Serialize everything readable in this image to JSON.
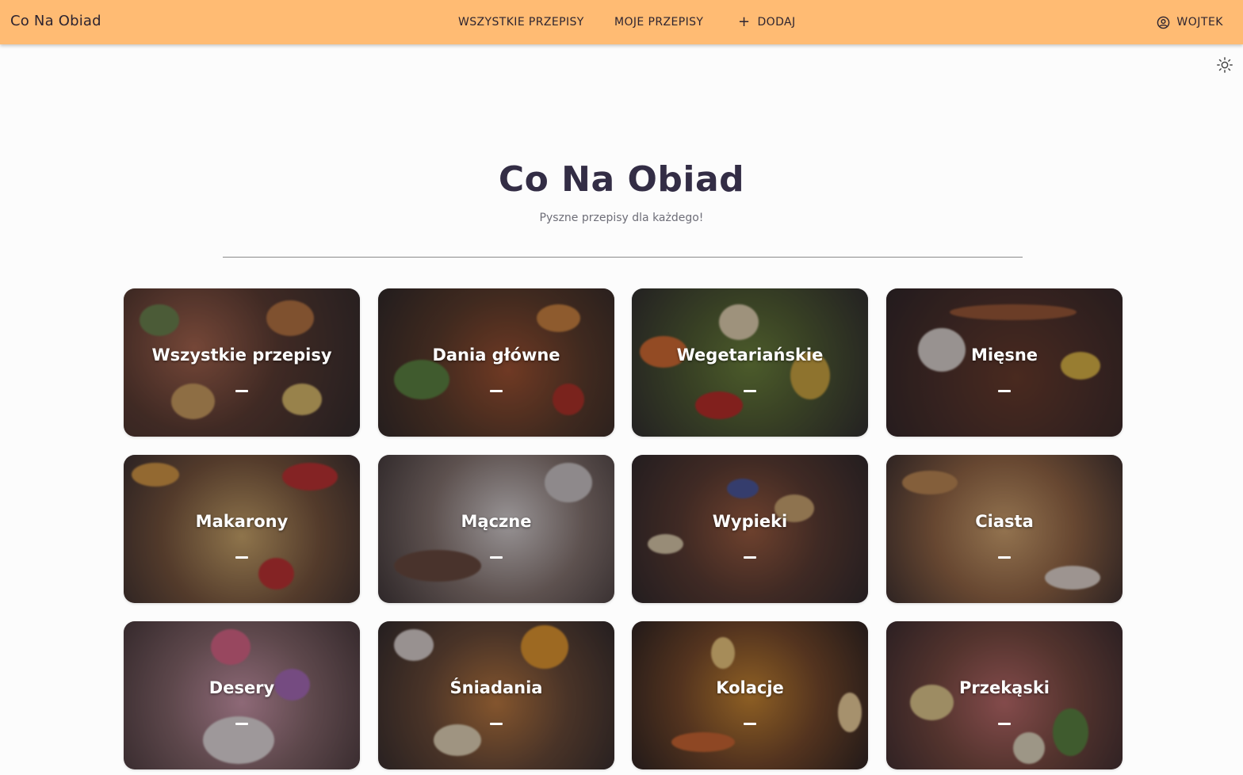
{
  "header": {
    "brand": "Co Na Obiad",
    "nav": {
      "all_recipes": "WSZYSTKIE PRZEPISY",
      "my_recipes": "MOJE PRZEPISY",
      "add": "DODAJ"
    },
    "user": "WOJTEK"
  },
  "hero": {
    "title": "Co Na Obiad",
    "subtitle": "Pyszne przepisy dla każdego!"
  },
  "categories": [
    {
      "label": "Wszystkie przepisy",
      "icon": "mixed-dishes-photo"
    },
    {
      "label": "Dania główne",
      "icon": "grilled-chicken-photo"
    },
    {
      "label": "Wegetariańskie",
      "icon": "vegetable-bowl-photo"
    },
    {
      "label": "Mięsne",
      "icon": "steak-plate-photo"
    },
    {
      "label": "Makarony",
      "icon": "pasta-photo"
    },
    {
      "label": "Mączne",
      "icon": "flour-bowl-photo"
    },
    {
      "label": "Wypieki",
      "icon": "blueberry-bake-photo"
    },
    {
      "label": "Ciasta",
      "icon": "crumble-cake-photo"
    },
    {
      "label": "Desery",
      "icon": "macaron-dessert-photo"
    },
    {
      "label": "Śniadania",
      "icon": "breakfast-plate-photo"
    },
    {
      "label": "Kolacje",
      "icon": "candle-dinner-photo"
    },
    {
      "label": "Przekąski",
      "icon": "snack-platter-photo"
    }
  ],
  "colors": {
    "header_bg": "#ffbb73",
    "page_bg": "#fcfcfc",
    "title_text": "#332d45"
  }
}
